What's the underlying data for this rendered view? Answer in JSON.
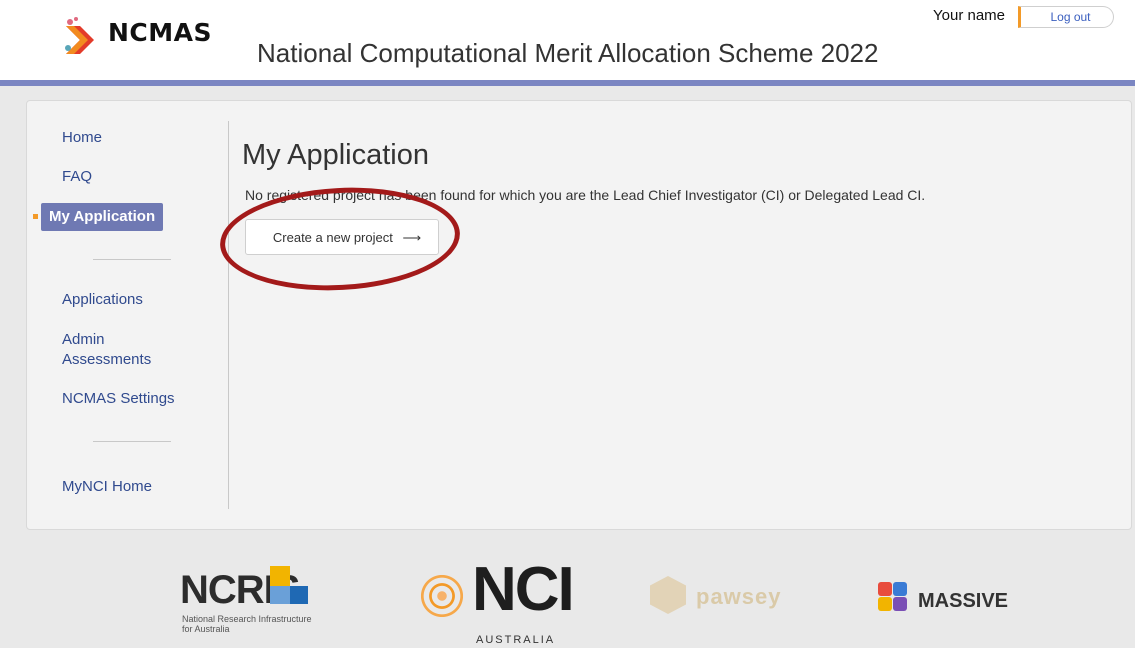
{
  "header": {
    "logo_text": "NCMAS",
    "title": "National Computational Merit Allocation Scheme 2022",
    "user_name": "Your name",
    "logout_label": "Log out"
  },
  "sidebar": {
    "items": [
      {
        "label": "Home"
      },
      {
        "label": "FAQ"
      },
      {
        "label": "My Application",
        "active": true
      },
      {
        "label": "Applications"
      },
      {
        "label": "Admin Assessments"
      },
      {
        "label": "NCMAS Settings"
      },
      {
        "label": "MyNCI Home"
      }
    ]
  },
  "main": {
    "heading": "My Application",
    "message": "No registered project has been found for which you are the Lead Chief Investigator (CI) or Delegated Lead CI.",
    "create_button_label": "Create a new project",
    "create_button_arrow": "⟶"
  },
  "footer": {
    "ncris_word": "NCRIS",
    "ncris_sub": "National Research Infrastructure for Australia",
    "nci_word": "NCI",
    "nci_sub": "AUSTRALIA",
    "pawsey_word": "pawsey",
    "massive_word": "MASSIVE"
  },
  "colors": {
    "header_bar": "#7b86c2",
    "active_nav": "#6f79b3",
    "accent_orange": "#f39a28",
    "highlight_ring": "#a31a1a",
    "link": "#304a8e"
  }
}
